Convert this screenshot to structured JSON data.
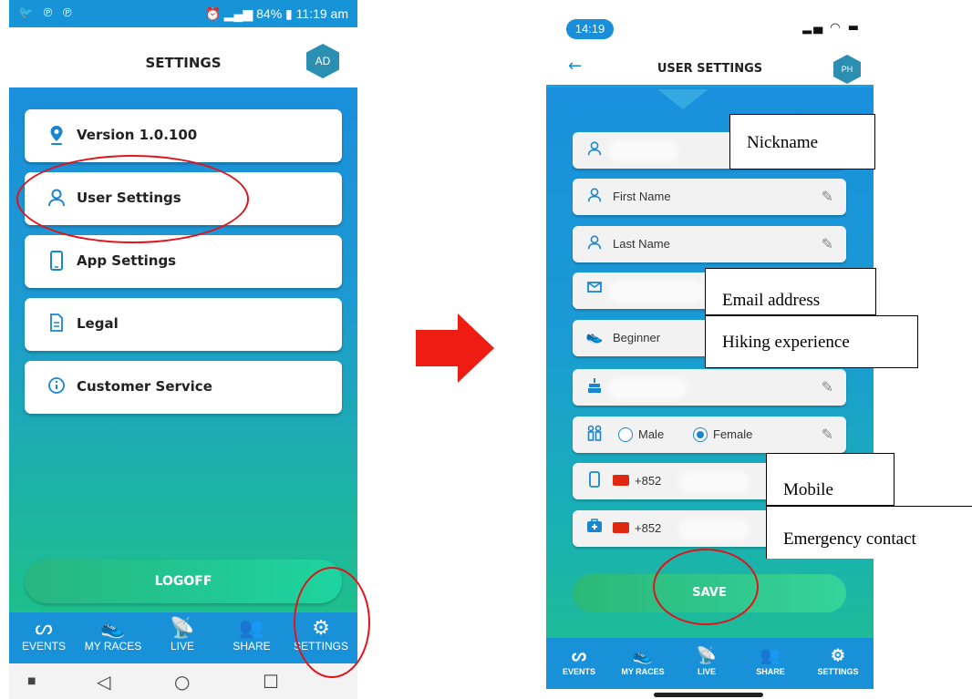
{
  "left_phone": {
    "status_bar": {
      "time": "11:19 am",
      "battery": "84%"
    },
    "header": {
      "title": "SETTINGS",
      "avatar": "AD"
    },
    "menu": [
      {
        "label": "Version 1.0.100",
        "icon": "location-pin-icon"
      },
      {
        "label": "User Settings",
        "icon": "user-icon"
      },
      {
        "label": "App Settings",
        "icon": "phone-icon"
      },
      {
        "label": "Legal",
        "icon": "document-icon"
      },
      {
        "label": "Customer Service",
        "icon": "info-icon"
      }
    ],
    "logoff_label": "LOGOFF",
    "nav": [
      "EVENTS",
      "MY RACES",
      "LIVE",
      "SHARE",
      "SETTINGS"
    ]
  },
  "right_phone": {
    "status_bar": {
      "time": "14:19"
    },
    "header": {
      "title": "USER SETTINGS",
      "avatar": "PH"
    },
    "fields": {
      "first_name_placeholder": "First Name",
      "last_name_placeholder": "Last Name",
      "experience": "Beginner",
      "gender_male": "Male",
      "gender_female": "Female",
      "selected_gender": "Female",
      "mobile_code": "+852",
      "emergency_code": "+852"
    },
    "save_label": "SAVE",
    "nav": [
      "EVENTS",
      "MY RACES",
      "LIVE",
      "SHARE",
      "SETTINGS"
    ]
  },
  "annotations": {
    "nickname": "Nickname",
    "email": "Email address",
    "hiking": "Hiking experience",
    "mobile": "Mobile",
    "emergency": "Emergency contact"
  },
  "colors": {
    "brand_blue": "#1891d9",
    "highlight_red": "#e0141b",
    "save_green": "#2ab877"
  }
}
